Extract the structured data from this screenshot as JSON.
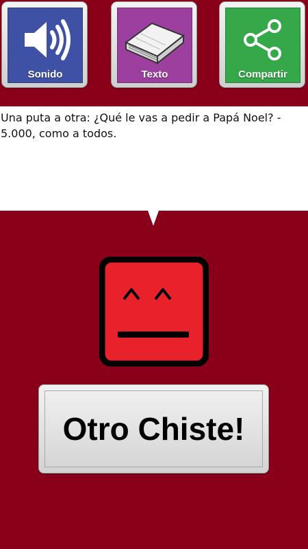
{
  "toolbar": {
    "sound": {
      "label": "Sonido",
      "icon": "speaker-icon",
      "color": "#3f51a5"
    },
    "text": {
      "label": "Texto",
      "icon": "book-icon",
      "color": "#9c3f9e"
    },
    "share": {
      "label": "Compartir",
      "icon": "share-icon",
      "color": "#35a84a"
    }
  },
  "joke": {
    "text": "Una puta a otra: ¿Qué le vas a pedir a Papá Noel? - 5.000, como a todos."
  },
  "face": {
    "icon": "smiling-face-icon",
    "color": "#e8212b"
  },
  "action": {
    "label": "Otro Chiste!"
  },
  "colors": {
    "background": "#8a0019",
    "panel": "#ffffff"
  }
}
